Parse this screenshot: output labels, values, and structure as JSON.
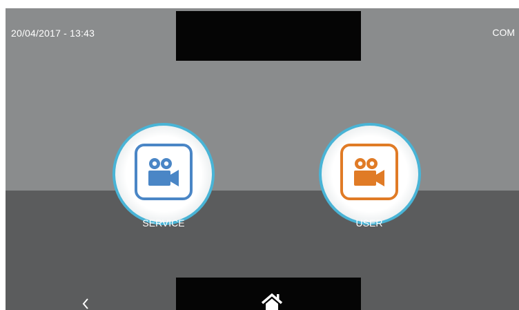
{
  "status_bar": {
    "datetime": "20/04/2017 - 13:43",
    "com": "COM"
  },
  "buttons": [
    {
      "label": "SERVICE",
      "icon": "video-camera-icon",
      "color": "#4a86c6"
    },
    {
      "label": "USER",
      "icon": "video-camera-icon",
      "color": "#e07b26"
    }
  ],
  "nav": {
    "back_icon": "chevron-left-icon",
    "home_icon": "home-icon"
  },
  "colors": {
    "top_background": "#8a8c8d",
    "bottom_background": "#5b5c5d",
    "circle_ring": "#49b4d6"
  }
}
